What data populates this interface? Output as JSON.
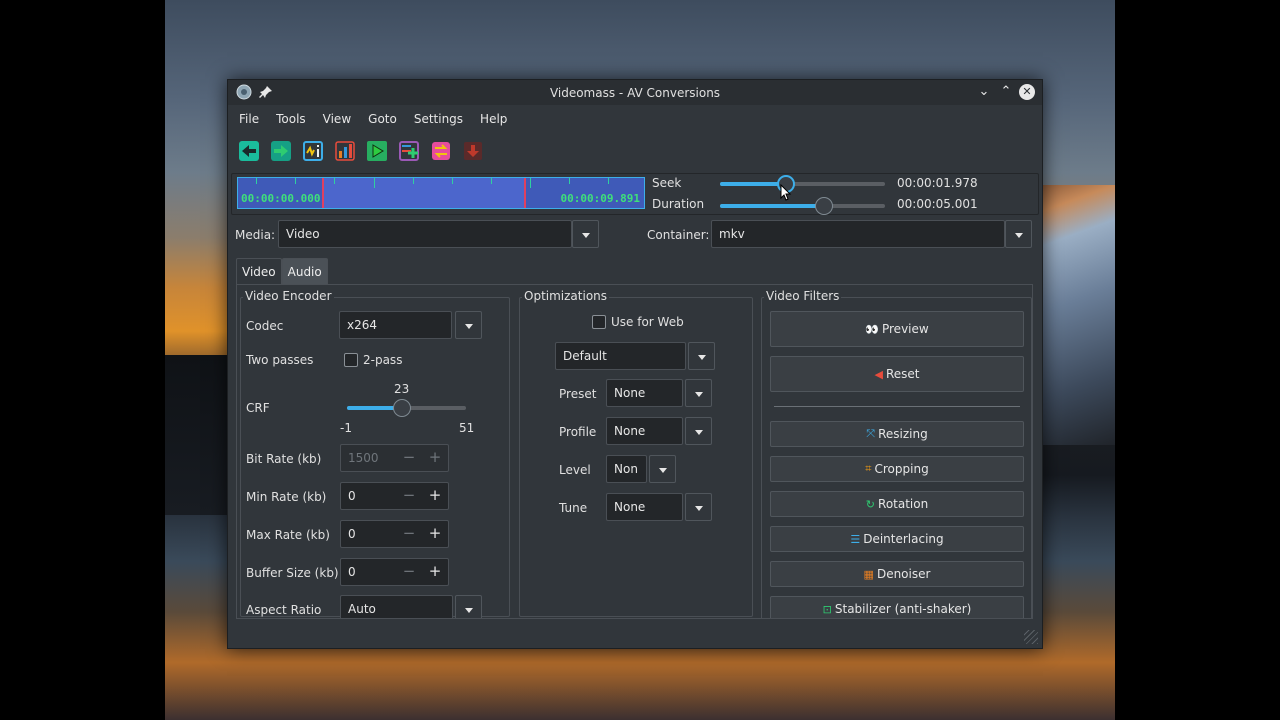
{
  "window": {
    "title": "Videomass - AV Conversions"
  },
  "menu": [
    "File",
    "Tools",
    "View",
    "Goto",
    "Settings",
    "Help"
  ],
  "toolbar_icons": [
    "arrow-left-icon",
    "arrow-right-icon",
    "media-info-icon",
    "stats-chart-icon",
    "play-icon",
    "add-queue-icon",
    "convert-icon",
    "stop-icon"
  ],
  "timeline": {
    "start": "00:00:00.000",
    "end": "00:00:09.891"
  },
  "seek": {
    "label": "Seek",
    "value": "00:00:01.978",
    "level": 0.4
  },
  "duration": {
    "label": "Duration",
    "value": "00:00:05.001",
    "level": 0.63
  },
  "media": {
    "label": "Media:",
    "value": "Video"
  },
  "container": {
    "label": "Container:",
    "value": "mkv"
  },
  "tabs": [
    "Video",
    "Audio"
  ],
  "encoder": {
    "group_title": "Video Encoder",
    "codec_label": "Codec",
    "codec_value": "x264",
    "two_passes_label": "Two passes",
    "two_pass_check": "2-pass",
    "crf_label": "CRF",
    "crf_value": "23",
    "crf_min": "-1",
    "crf_max": "51",
    "crf_level": 0.46,
    "bitrate_label": "Bit Rate (kb)",
    "bitrate_value": "1500",
    "minrate_label": "Min Rate (kb)",
    "minrate_value": "0",
    "maxrate_label": "Max Rate (kb)",
    "maxrate_value": "0",
    "bufsize_label": "Buffer Size (kb)",
    "bufsize_value": "0",
    "aspect_label": "Aspect Ratio",
    "aspect_value": "Auto"
  },
  "optimizations": {
    "group_title": "Optimizations",
    "web_label": "Use for Web",
    "preset_combo": "Default",
    "preset_label": "Preset",
    "preset_value": "None",
    "profile_label": "Profile",
    "profile_value": "None",
    "level_label": "Level",
    "level_value": "Non",
    "tune_label": "Tune",
    "tune_value": "None"
  },
  "filters": {
    "group_title": "Video Filters",
    "preview": "Preview",
    "reset": "Reset",
    "resizing": "Resizing",
    "cropping": "Cropping",
    "rotation": "Rotation",
    "deinterlacing": "Deinterlacing",
    "denoiser": "Denoiser",
    "stabilizer": "Stabilizer (anti-shaker)"
  },
  "colors": {
    "accent": "#3daee9",
    "window_bg": "#31363b",
    "timeline_text": "#3fe07a"
  }
}
